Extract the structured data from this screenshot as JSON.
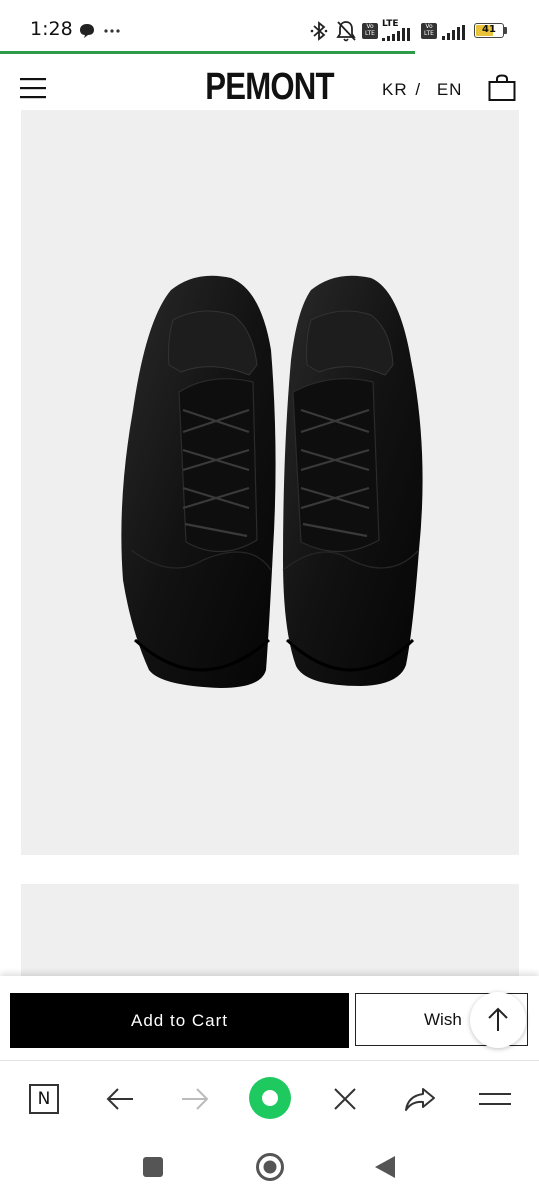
{
  "status_bar": {
    "time": "1:28",
    "icons": [
      "chat-bubble-icon",
      "more-dots-icon",
      "bluetooth-icon",
      "bell-off-icon",
      "volte-icon",
      "lte-signal-icon",
      "volte-icon",
      "signal-icon",
      "battery-icon"
    ],
    "lte_label": "LTE",
    "volte_label": "Vo LTE",
    "battery_level": "41",
    "battery_color": "#e8c33a"
  },
  "page_load_progress": 0.77,
  "header": {
    "menu_icon": "hamburger-icon",
    "logo": "PEMONT",
    "lang_kr": "KR",
    "lang_sep": "/",
    "lang_en": "EN",
    "cart_icon": "shopping-bag-icon"
  },
  "product": {
    "image_1": "black-leather-sneakers-photo",
    "image_2": "product-photo-placeholder",
    "image_bg": "#efefef"
  },
  "purchase_bar": {
    "add_to_cart": "Add to Cart",
    "wish": "Wish",
    "scroll_top_icon": "arrow-up-icon"
  },
  "browser_toolbar": {
    "items": [
      "naver-n-icon",
      "back-arrow-icon",
      "forward-arrow-icon",
      "green-home-dot-icon",
      "close-x-icon",
      "share-arrow-icon",
      "menu-lines-icon"
    ],
    "n_label": "N",
    "accent": "#1ec95f"
  },
  "android_nav": {
    "items": [
      "recent-apps-square-icon",
      "home-circle-icon",
      "back-triangle-icon"
    ]
  }
}
